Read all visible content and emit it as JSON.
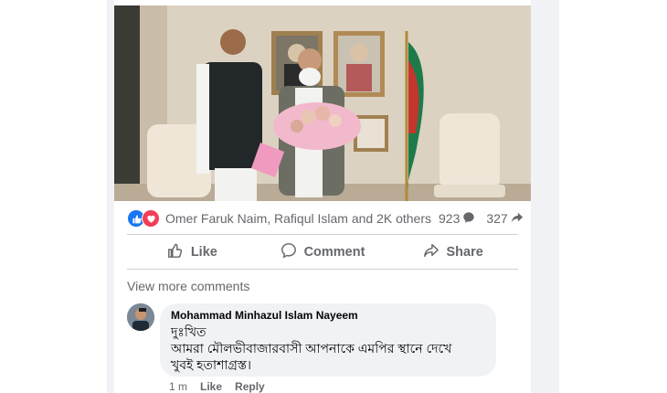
{
  "post": {
    "reactions": {
      "names": "Omer Faruk Naim, Rafiqul Islam and 2K others",
      "comment_count": "923",
      "share_count": "327",
      "icons": [
        "like-icon",
        "love-icon",
        "comment-icon",
        "share-icon"
      ]
    },
    "actions": {
      "like": "Like",
      "comment": "Comment",
      "share": "Share"
    },
    "view_more": "View more comments"
  },
  "comment": {
    "author": "Mohammad Minhazul Islam Nayeem",
    "line1": "দুঃখিত",
    "line2": "আমরা মৌলভীবাজারবাসী আপনাকে এমপির স্থানে দেখে",
    "line3": "খুবই হতাশাগ্রস্ত।",
    "time": "1 m",
    "like": "Like",
    "reply": "Reply"
  },
  "colors": {
    "accent": "#1877f2",
    "love": "#f33e58",
    "text_secondary": "#65676b",
    "bubble": "#f0f2f5"
  }
}
